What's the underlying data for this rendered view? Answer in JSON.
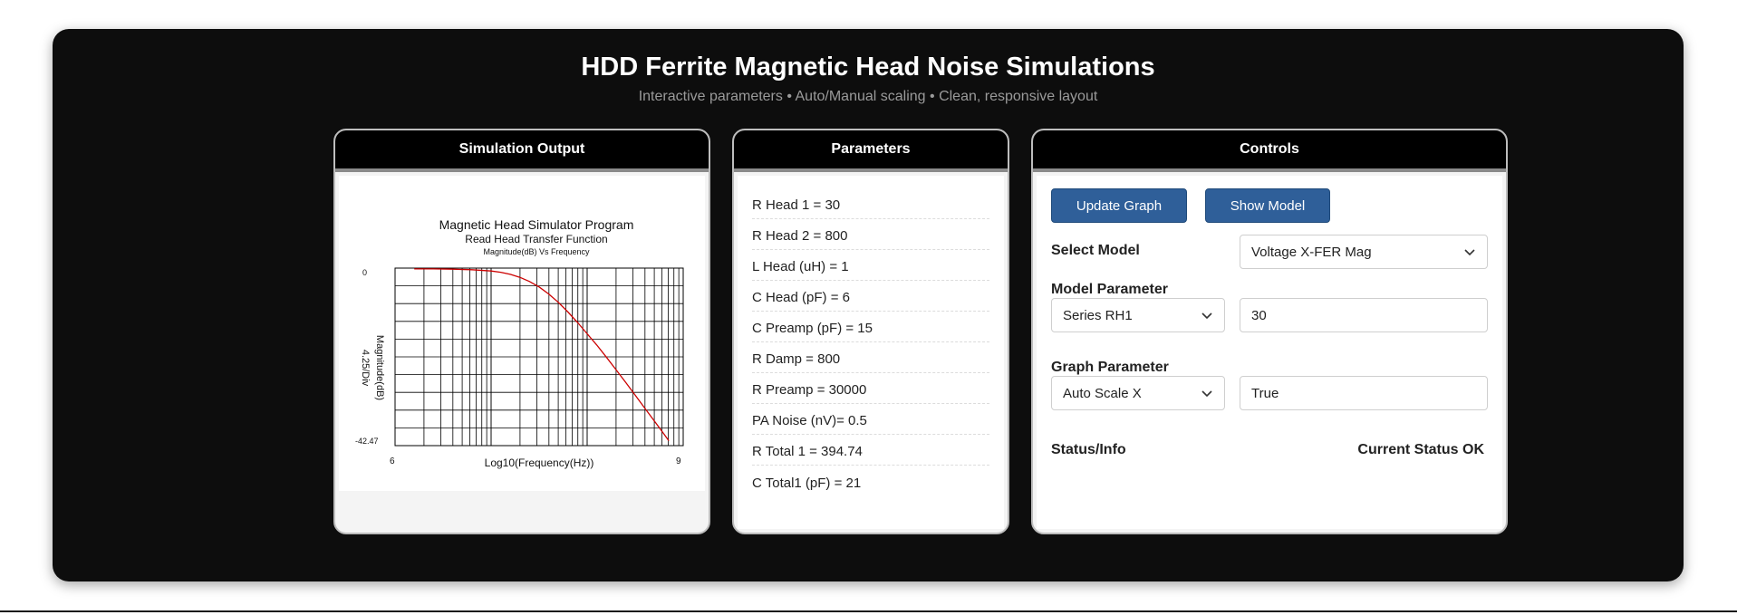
{
  "header": {
    "title": "HDD Ferrite Magnetic Head Noise Simulations",
    "subtitle": "Interactive parameters • Auto/Manual scaling • Clean, responsive layout"
  },
  "panels": {
    "simulation": {
      "title": "Simulation Output"
    },
    "parameters": {
      "title": "Parameters"
    },
    "controls": {
      "title": "Controls"
    }
  },
  "parameters": {
    "items": [
      "R Head 1 = 30",
      "R Head 2 = 800",
      "L Head (uH) = 1",
      "C Head (pF) = 6",
      "C Preamp (pF) = 15",
      "R Damp = 800",
      "R Preamp = 30000",
      "PA Noise (nV)= 0.5",
      "R Total 1 = 394.74",
      "C Total1 (pF) = 21"
    ]
  },
  "controls": {
    "update_label": "Update Graph",
    "show_model_label": "Show Model",
    "select_model_label": "Select Model",
    "select_model_value": "Voltage X-FER Mag",
    "model_param_label": "Model Parameter",
    "model_param_select": "Series RH1",
    "model_param_value": "30",
    "graph_param_label": "Graph Parameter",
    "graph_param_select": "Auto Scale X",
    "graph_param_value": "True",
    "status_label": "Status/Info",
    "status_value": "Current Status OK"
  },
  "chart_data": {
    "type": "line",
    "title": "Magnetic Head Simulator Program",
    "subtitle": "Read Head Transfer Function",
    "subtitle2": "Magnitude(dB) Vs Frequency",
    "xlabel": "Log10(Frequency(Hz))",
    "ylabel": "Magnitude(dB)",
    "ylabel2": "4.25/Div",
    "x_scale": "log",
    "xlim": [
      6,
      9
    ],
    "ylim": [
      -42.47,
      0
    ],
    "x_tick_labels": [
      "6",
      "9"
    ],
    "y_tick_labels": [
      "0",
      "-42.47"
    ],
    "grid": true,
    "series_color": "#cc0000",
    "series": [
      {
        "x": [
          6.2,
          6.4,
          6.6,
          6.8,
          7.0,
          7.1,
          7.2,
          7.3,
          7.4,
          7.5,
          7.6,
          7.7,
          7.8,
          7.9,
          8.0,
          8.1,
          8.2,
          8.3,
          8.4,
          8.5,
          8.6,
          8.7,
          8.8,
          8.85
        ],
        "values": [
          -0.2,
          -0.2,
          -0.25,
          -0.4,
          -0.7,
          -1.0,
          -1.5,
          -2.2,
          -3.2,
          -4.5,
          -6.2,
          -8.2,
          -10.5,
          -13.0,
          -15.7,
          -18.4,
          -21.3,
          -24.3,
          -27.3,
          -30.4,
          -33.5,
          -36.6,
          -39.7,
          -41.3
        ]
      }
    ]
  }
}
